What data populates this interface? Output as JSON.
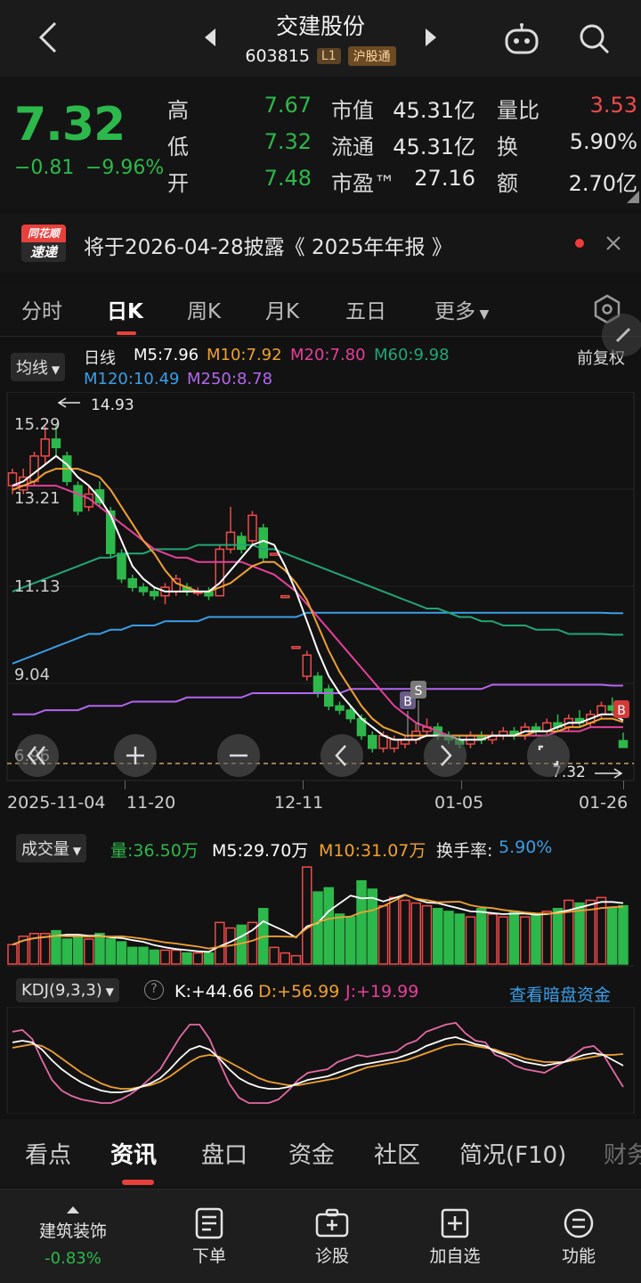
{
  "header": {
    "title": "交建股份",
    "code": "603815",
    "level": "L1",
    "connect": "沪股通"
  },
  "quote": {
    "price": "7.32",
    "change": "−0.81",
    "change_pct": "−9.96%",
    "labels": {
      "high": "高",
      "low": "低",
      "open": "开",
      "mktcap": "市值",
      "float": "流通",
      "pe": "市盈™",
      "volratio": "量比",
      "turnover": "换",
      "amount": "额"
    },
    "values": {
      "high": "7.67",
      "low": "7.32",
      "open": "7.48",
      "mktcap": "45.31亿",
      "float": "45.31亿",
      "pe": "27.16",
      "volratio": "3.53",
      "turnover": "5.90%",
      "amount": "2.70亿"
    },
    "colors": {
      "up": "#f04a4a",
      "down": "#2db84b"
    }
  },
  "notice": {
    "brand_line1": "同花顺",
    "brand_line2": "速递",
    "text": "将于2026-04-28披露《 2025年年报 》"
  },
  "ktabs": [
    "分时",
    "日K",
    "周K",
    "月K",
    "五日",
    "更多"
  ],
  "marow": {
    "ma_button": "均线",
    "period": "日线",
    "m5": "M5:7.96",
    "m10": "M10:7.92",
    "m20": "M20:7.80",
    "m60": "M60:9.98",
    "m120": "M120:10.49",
    "m250": "M250:8.78",
    "adjust": "前复权"
  },
  "chart_data": {
    "type": "candlestick",
    "y_ticks": [
      "15.29",
      "13.21",
      "11.13",
      "9.04",
      "6.96"
    ],
    "ylim": [
      6.96,
      15.29
    ],
    "high_marker": "14.93",
    "low_marker": "7.32",
    "x_ticks": [
      "2025-11-04",
      "11-20",
      "12-11",
      "01-05",
      "01-26"
    ],
    "trade_marks": [
      "B",
      "S",
      "B"
    ],
    "candles": [
      {
        "o": 13.5,
        "c": 13.8,
        "h": 13.9,
        "l": 13.3
      },
      {
        "o": 13.4,
        "c": 13.7,
        "h": 13.9,
        "l": 13.3
      },
      {
        "o": 13.6,
        "c": 14.2,
        "h": 14.3,
        "l": 13.5
      },
      {
        "o": 14.2,
        "c": 14.6,
        "h": 14.9,
        "l": 14.0
      },
      {
        "o": 14.6,
        "c": 14.4,
        "h": 14.93,
        "l": 14.2
      },
      {
        "o": 14.2,
        "c": 13.6,
        "h": 14.3,
        "l": 13.5
      },
      {
        "o": 13.5,
        "c": 12.9,
        "h": 13.6,
        "l": 12.8
      },
      {
        "o": 13.0,
        "c": 13.3,
        "h": 13.5,
        "l": 12.9
      },
      {
        "o": 13.4,
        "c": 13.1,
        "h": 13.6,
        "l": 13.0
      },
      {
        "o": 12.9,
        "c": 11.9,
        "h": 13.0,
        "l": 11.8
      },
      {
        "o": 11.9,
        "c": 11.3,
        "h": 12.0,
        "l": 11.2
      },
      {
        "o": 11.3,
        "c": 11.1,
        "h": 11.4,
        "l": 11.0
      },
      {
        "o": 11.1,
        "c": 11.0,
        "h": 11.2,
        "l": 10.9
      },
      {
        "o": 11.0,
        "c": 10.9,
        "h": 11.1,
        "l": 10.8
      },
      {
        "o": 10.9,
        "c": 11.1,
        "h": 11.2,
        "l": 10.7
      },
      {
        "o": 11.0,
        "c": 11.3,
        "h": 11.4,
        "l": 10.9
      },
      {
        "o": 11.1,
        "c": 11.0,
        "h": 11.2,
        "l": 10.9
      },
      {
        "o": 11.0,
        "c": 11.0,
        "h": 11.1,
        "l": 10.9
      },
      {
        "o": 11.0,
        "c": 10.9,
        "h": 11.1,
        "l": 10.8
      },
      {
        "o": 10.9,
        "c": 12.0,
        "h": 12.1,
        "l": 10.9
      },
      {
        "o": 12.0,
        "c": 12.4,
        "h": 13.0,
        "l": 11.9
      },
      {
        "o": 12.3,
        "c": 12.0,
        "h": 12.4,
        "l": 11.9
      },
      {
        "o": 12.2,
        "c": 12.8,
        "h": 12.9,
        "l": 12.1
      },
      {
        "o": 12.5,
        "c": 11.8,
        "h": 12.6,
        "l": 11.7
      },
      {
        "o": 11.9,
        "c": 11.9,
        "h": 11.9,
        "l": 11.9
      },
      {
        "o": 10.9,
        "c": 10.9,
        "h": 10.9,
        "l": 10.9
      },
      {
        "o": 9.7,
        "c": 9.7,
        "h": 9.7,
        "l": 9.7
      },
      {
        "o": 9.0,
        "c": 9.5,
        "h": 9.6,
        "l": 8.9
      },
      {
        "o": 9.0,
        "c": 8.6,
        "h": 9.1,
        "l": 8.5
      },
      {
        "o": 8.7,
        "c": 8.3,
        "h": 8.8,
        "l": 8.2
      },
      {
        "o": 8.3,
        "c": 8.2,
        "h": 8.4,
        "l": 8.1
      },
      {
        "o": 8.2,
        "c": 8.0,
        "h": 8.3,
        "l": 7.9
      },
      {
        "o": 8.0,
        "c": 7.6,
        "h": 8.1,
        "l": 7.5
      },
      {
        "o": 7.6,
        "c": 7.3,
        "h": 7.7,
        "l": 7.2
      },
      {
        "o": 7.3,
        "c": 7.6,
        "h": 7.7,
        "l": 7.2
      },
      {
        "o": 7.3,
        "c": 7.5,
        "h": 7.6,
        "l": 7.2
      },
      {
        "o": 7.4,
        "c": 7.5,
        "h": 7.6,
        "l": 7.3
      },
      {
        "o": 7.5,
        "c": 7.7,
        "h": 7.9,
        "l": 7.4
      },
      {
        "o": 7.7,
        "c": 7.8,
        "h": 8.0,
        "l": 7.6
      },
      {
        "o": 7.8,
        "c": 7.6,
        "h": 7.9,
        "l": 7.5
      },
      {
        "o": 7.6,
        "c": 7.5,
        "h": 7.7,
        "l": 7.4
      },
      {
        "o": 7.5,
        "c": 7.4,
        "h": 7.6,
        "l": 7.3
      },
      {
        "o": 7.4,
        "c": 7.6,
        "h": 7.7,
        "l": 7.3
      },
      {
        "o": 7.6,
        "c": 7.5,
        "h": 7.7,
        "l": 7.4
      },
      {
        "o": 7.5,
        "c": 7.6,
        "h": 7.7,
        "l": 7.4
      },
      {
        "o": 7.6,
        "c": 7.7,
        "h": 7.8,
        "l": 7.5
      },
      {
        "o": 7.7,
        "c": 7.6,
        "h": 7.8,
        "l": 7.5
      },
      {
        "o": 7.6,
        "c": 7.8,
        "h": 7.9,
        "l": 7.5
      },
      {
        "o": 7.8,
        "c": 7.7,
        "h": 7.9,
        "l": 7.6
      },
      {
        "o": 7.7,
        "c": 7.9,
        "h": 8.0,
        "l": 7.6
      },
      {
        "o": 7.9,
        "c": 7.8,
        "h": 8.1,
        "l": 7.7
      },
      {
        "o": 7.8,
        "c": 8.0,
        "h": 8.1,
        "l": 7.7
      },
      {
        "o": 8.0,
        "c": 7.9,
        "h": 8.2,
        "l": 7.8
      },
      {
        "o": 7.9,
        "c": 8.1,
        "h": 8.2,
        "l": 7.8
      },
      {
        "o": 8.1,
        "c": 8.3,
        "h": 8.4,
        "l": 8.0
      },
      {
        "o": 8.3,
        "c": 8.2,
        "h": 8.5,
        "l": 8.1
      },
      {
        "o": 7.48,
        "c": 7.32,
        "h": 7.67,
        "l": 7.32
      }
    ],
    "ma5": [
      13.5,
      13.6,
      13.8,
      14.0,
      14.2,
      14.0,
      13.7,
      13.5,
      13.2,
      12.8,
      12.2,
      11.6,
      11.3,
      11.1,
      11.0,
      11.0,
      11.0,
      11.0,
      11.0,
      11.2,
      11.5,
      11.8,
      12.1,
      12.2,
      12.1,
      11.6,
      11.0,
      10.3,
      9.6,
      9.0,
      8.6,
      8.3,
      8.0,
      7.8,
      7.6,
      7.5,
      7.5,
      7.5,
      7.6,
      7.6,
      7.6,
      7.5,
      7.5,
      7.5,
      7.6,
      7.6,
      7.6,
      7.7,
      7.7,
      7.7,
      7.8,
      7.9,
      7.9,
      8.0,
      8.1,
      8.1,
      7.96
    ],
    "ma10": [
      13.4,
      13.5,
      13.6,
      13.8,
      13.9,
      13.9,
      13.9,
      13.8,
      13.7,
      13.4,
      13.0,
      12.6,
      12.2,
      11.9,
      11.5,
      11.2,
      11.1,
      11.0,
      11.0,
      11.1,
      11.2,
      11.4,
      11.6,
      11.7,
      11.7,
      11.5,
      11.2,
      10.8,
      10.2,
      9.6,
      9.1,
      8.7,
      8.3,
      8.0,
      7.8,
      7.7,
      7.6,
      7.6,
      7.6,
      7.6,
      7.6,
      7.6,
      7.6,
      7.6,
      7.6,
      7.6,
      7.6,
      7.6,
      7.7,
      7.7,
      7.7,
      7.8,
      7.8,
      7.9,
      8.0,
      8.0,
      7.92
    ],
    "ma20": [
      13.5,
      13.5,
      13.5,
      13.5,
      13.5,
      13.4,
      13.3,
      13.2,
      13.0,
      12.8,
      12.6,
      12.4,
      12.2,
      12.0,
      11.9,
      11.8,
      11.8,
      11.7,
      11.7,
      11.7,
      11.7,
      11.7,
      11.6,
      11.5,
      11.4,
      11.2,
      11.0,
      10.7,
      10.4,
      10.1,
      9.8,
      9.5,
      9.2,
      8.9,
      8.6,
      8.3,
      8.1,
      7.9,
      7.8,
      7.7,
      7.6,
      7.6,
      7.6,
      7.6,
      7.6,
      7.6,
      7.6,
      7.6,
      7.6,
      7.6,
      7.7,
      7.7,
      7.7,
      7.8,
      7.8,
      7.8,
      7.8
    ],
    "ma60": [
      11.0,
      11.1,
      11.2,
      11.3,
      11.4,
      11.5,
      11.6,
      11.7,
      11.8,
      11.8,
      11.9,
      11.9,
      11.9,
      12.0,
      12.0,
      12.0,
      12.0,
      12.1,
      12.1,
      12.1,
      12.1,
      12.1,
      12.1,
      12.0,
      12.0,
      11.9,
      11.8,
      11.7,
      11.6,
      11.5,
      11.4,
      11.3,
      11.2,
      11.1,
      11.0,
      10.9,
      10.8,
      10.7,
      10.6,
      10.6,
      10.5,
      10.4,
      10.4,
      10.3,
      10.3,
      10.2,
      10.2,
      10.2,
      10.1,
      10.1,
      10.1,
      10.0,
      10.0,
      10.0,
      10.0,
      9.98,
      9.98
    ],
    "ma120": [
      9.3,
      9.4,
      9.5,
      9.6,
      9.7,
      9.8,
      9.9,
      10.0,
      10.0,
      10.1,
      10.1,
      10.2,
      10.2,
      10.2,
      10.3,
      10.3,
      10.3,
      10.3,
      10.4,
      10.4,
      10.4,
      10.4,
      10.4,
      10.4,
      10.4,
      10.4,
      10.4,
      10.5,
      10.5,
      10.5,
      10.5,
      10.5,
      10.5,
      10.5,
      10.5,
      10.5,
      10.5,
      10.5,
      10.5,
      10.5,
      10.5,
      10.5,
      10.5,
      10.5,
      10.5,
      10.5,
      10.5,
      10.5,
      10.5,
      10.5,
      10.5,
      10.5,
      10.5,
      10.5,
      10.5,
      10.49,
      10.49
    ],
    "ma250": [
      8.1,
      8.1,
      8.1,
      8.2,
      8.2,
      8.2,
      8.2,
      8.3,
      8.3,
      8.3,
      8.3,
      8.4,
      8.4,
      8.4,
      8.4,
      8.4,
      8.5,
      8.5,
      8.5,
      8.5,
      8.5,
      8.5,
      8.6,
      8.6,
      8.6,
      8.6,
      8.6,
      8.6,
      8.6,
      8.6,
      8.6,
      8.7,
      8.7,
      8.7,
      8.7,
      8.7,
      8.7,
      8.7,
      8.7,
      8.7,
      8.7,
      8.7,
      8.7,
      8.7,
      8.8,
      8.8,
      8.8,
      8.8,
      8.8,
      8.8,
      8.8,
      8.8,
      8.8,
      8.8,
      8.8,
      8.78,
      8.78
    ]
  },
  "volume": {
    "label": "成交量",
    "vol": "量:36.50万",
    "m5": "M5:29.70万",
    "m10": "M10:31.07万",
    "turnover_label": "换手率:",
    "turnover": "5.90%",
    "bars": [
      14,
      20,
      22,
      22,
      24,
      18,
      20,
      18,
      22,
      18,
      16,
      12,
      12,
      10,
      10,
      10,
      8,
      8,
      8,
      30,
      26,
      28,
      30,
      40,
      12,
      8,
      6,
      70,
      52,
      55,
      36,
      34,
      60,
      54,
      42,
      48,
      46,
      44,
      42,
      40,
      38,
      36,
      34,
      40,
      36,
      34,
      38,
      34,
      36,
      38,
      40,
      46,
      44,
      46,
      48,
      40,
      42
    ]
  },
  "kdj": {
    "label": "KDJ(9,3,3)",
    "k": "K:+44.66",
    "d": "D:+56.99",
    "j": "J:+19.99",
    "link": "查看暗盘资金",
    "k_series": [
      70,
      72,
      70,
      62,
      50,
      40,
      32,
      25,
      20,
      16,
      14,
      14,
      16,
      20,
      24,
      30,
      40,
      52,
      62,
      66,
      62,
      52,
      40,
      30,
      24,
      20,
      18,
      18,
      20,
      24,
      28,
      30,
      32,
      36,
      40,
      44,
      46,
      48,
      50,
      52,
      56,
      60,
      66,
      70,
      74,
      76,
      72,
      68,
      66,
      60,
      56,
      52,
      48,
      46,
      44,
      46,
      48,
      52,
      56,
      58,
      56,
      50,
      44
    ],
    "d_series": [
      64,
      66,
      68,
      66,
      60,
      52,
      44,
      36,
      30,
      24,
      20,
      18,
      18,
      20,
      22,
      26,
      32,
      40,
      48,
      54,
      56,
      54,
      48,
      42,
      36,
      30,
      26,
      24,
      22,
      22,
      24,
      26,
      28,
      30,
      34,
      38,
      42,
      44,
      46,
      48,
      50,
      54,
      58,
      62,
      66,
      68,
      68,
      66,
      64,
      62,
      58,
      56,
      52,
      50,
      48,
      48,
      48,
      50,
      52,
      54,
      56,
      56,
      57
    ],
    "j_series": [
      82,
      84,
      74,
      50,
      28,
      16,
      10,
      6,
      4,
      2,
      2,
      6,
      12,
      20,
      30,
      40,
      58,
      76,
      90,
      90,
      74,
      48,
      24,
      8,
      2,
      2,
      2,
      6,
      16,
      28,
      36,
      38,
      40,
      48,
      52,
      56,
      54,
      56,
      58,
      60,
      68,
      72,
      82,
      86,
      90,
      92,
      80,
      72,
      70,
      56,
      52,
      44,
      40,
      38,
      36,
      42,
      48,
      56,
      64,
      66,
      56,
      38,
      20
    ]
  },
  "bottom_tabs": [
    "看点",
    "资讯",
    "盘口",
    "资金",
    "社区",
    "简况(F10)",
    "财务"
  ],
  "bottom_bar": {
    "sector": "建筑装饰",
    "sector_change": "-0.83%",
    "order": "下单",
    "diagnose": "诊股",
    "add": "加自选",
    "func": "功能"
  }
}
